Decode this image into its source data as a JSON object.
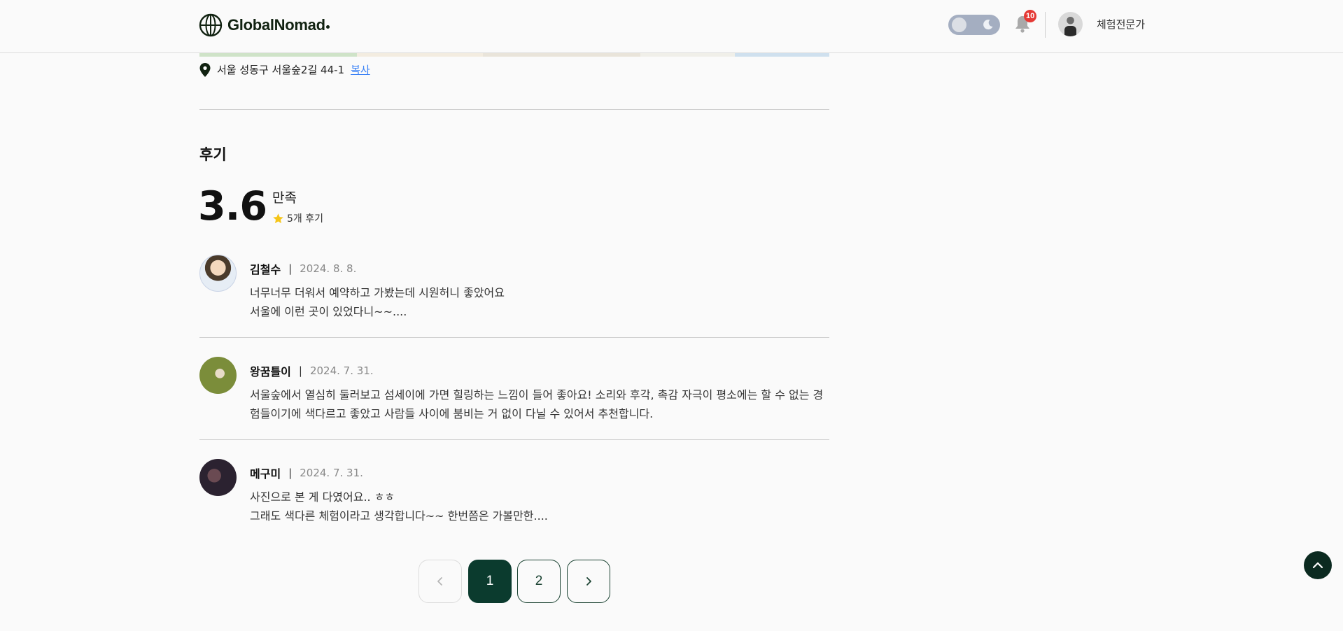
{
  "header": {
    "brand": "GlobalNomad",
    "notification_count": "10",
    "username": "체험전문가"
  },
  "location": {
    "address": "서울 성동구 서울숲2길 44-1",
    "copy_label": "복사"
  },
  "reviews": {
    "title": "후기",
    "score": "3.6",
    "score_label": "만족",
    "count_label": "5개 후기",
    "items": [
      {
        "author": "김철수",
        "separator": "|",
        "date": "2024. 8. 8.",
        "line1": "너무너무 더워서 예약하고 가봤는데 시원허니 좋았어요",
        "line2": "서울에 이런 곳이 있었다니~~...."
      },
      {
        "author": "왕꿈틀이",
        "separator": "|",
        "date": "2024. 7. 31.",
        "line1": "서울숲에서 열심히 둘러보고 섬세이에 가면 힐링하는 느낌이 들어 좋아요! 소리와 후각, 촉감 자극이 평소에는 할 수 없는 경",
        "line2": "험들이기에 색다르고 좋았고 사람들 사이에 붐비는 거 없이 다닐 수 있어서 추천합니다."
      },
      {
        "author": "메구미",
        "separator": "|",
        "date": "2024. 7. 31.",
        "line1": "사진으로 본 게 다였어요.. ㅎㅎ",
        "line2": "그래도 색다른 체험이라고 생각합니다~~ 한번쯤은 가볼만한...."
      }
    ]
  },
  "pagination": {
    "pages": [
      "1",
      "2"
    ],
    "current": "1"
  },
  "icons": {
    "logo": "globe-icon",
    "theme_toggle": "moon-icon",
    "notifications": "bell-icon",
    "address": "map-pin-icon",
    "rating": "star-icon",
    "prev": "chevron-left-icon",
    "next": "chevron-right-icon",
    "scroll_top": "chevron-up-icon"
  },
  "colors": {
    "brand": "#0b3b2e",
    "star": "#f5c518",
    "link": "#3b82f6",
    "badge": "#e53935"
  }
}
